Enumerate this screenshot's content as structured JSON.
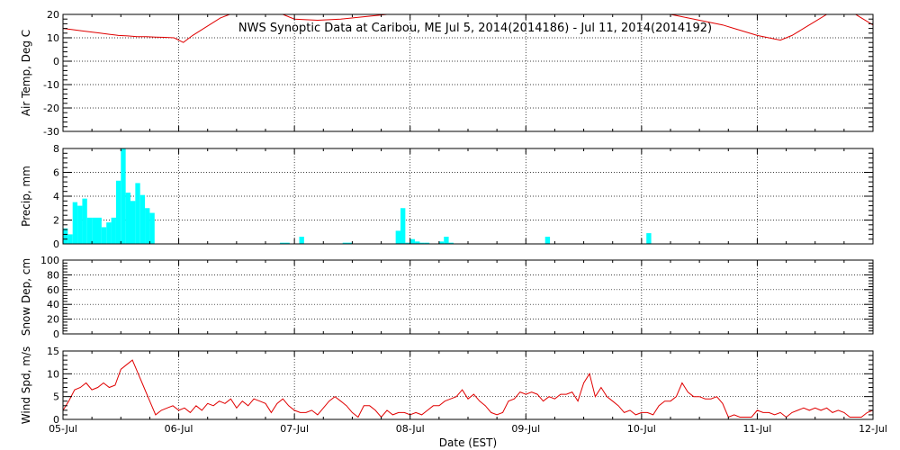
{
  "chart_data": {
    "type": "multi-panel",
    "title": "NWS Synoptic Data at Caribou, ME   Jul  5, 2014(2014186) - Jul 11, 2014(2014192)",
    "xlabel": "Date (EST)",
    "x_ticks": [
      "05-Jul",
      "06-Jul",
      "07-Jul",
      "08-Jul",
      "09-Jul",
      "10-Jul",
      "11-Jul",
      "12-Jul"
    ],
    "x_range_days": [
      0,
      7
    ],
    "colors": {
      "line": "#e00000",
      "bar": "#00ffff",
      "axis": "#000000"
    },
    "panels": [
      {
        "id": "air_temp",
        "type": "line",
        "ylabel": "Air Temp, Deg C",
        "ylim": [
          -30,
          20
        ],
        "yticks": [
          -30,
          -20,
          -10,
          0,
          10,
          20
        ],
        "grid": true,
        "series": [
          {
            "x": [
              0,
              0.08,
              0.16,
              0.24,
              0.32,
              0.4,
              0.48,
              0.56,
              0.64,
              0.72,
              0.8,
              0.88,
              0.96,
              1.04,
              1.12,
              1.2,
              1.28,
              1.36,
              1.44,
              1.52,
              1.6,
              1.7,
              1.8,
              1.9,
              2.0,
              2.2,
              2.4,
              2.6,
              2.8,
              3.0,
              3.2,
              3.4,
              3.6,
              3.8,
              4.0,
              4.2,
              4.4,
              4.6,
              4.8,
              5.0,
              5.1,
              5.2,
              5.3,
              5.4,
              5.5,
              5.6,
              5.7,
              5.8,
              5.9,
              6.0,
              6.1,
              6.2,
              6.3,
              6.4,
              6.5,
              6.6,
              6.7,
              6.8,
              6.9,
              7.0
            ],
            "values": [
              14,
              13.5,
              13,
              12.5,
              12,
              11.5,
              11,
              10.8,
              10.5,
              10.5,
              10.3,
              10.2,
              10,
              8,
              11,
              13.5,
              16,
              18.5,
              20,
              21,
              22,
              23,
              22,
              20,
              18,
              17.5,
              18,
              19,
              20,
              21,
              22,
              22.5,
              23,
              22,
              21,
              22,
              23,
              22,
              21,
              22,
              21.5,
              20.5,
              19.5,
              18.5,
              17.5,
              16.5,
              15.5,
              14,
              12.5,
              11,
              10,
              9,
              11,
              14,
              17,
              20,
              22,
              21.5,
              18.5,
              15.5
            ]
          }
        ]
      },
      {
        "id": "precip",
        "type": "bar",
        "ylabel": "Precip, mm",
        "ylim": [
          0,
          8
        ],
        "yticks": [
          0,
          2,
          4,
          6,
          8
        ],
        "grid": true,
        "bar_width_days": 0.0417,
        "series": [
          {
            "x": [
              0,
              0.0417,
              0.0833,
              0.125,
              0.1667,
              0.2083,
              0.25,
              0.2917,
              0.3333,
              0.375,
              0.4167,
              0.4583,
              0.5,
              0.5417,
              0.5833,
              0.625,
              0.6667,
              0.7083,
              0.75,
              1.875,
              1.9167,
              2.0417,
              2.4167,
              2.4583,
              2.875,
              2.9167,
              2.9583,
              3.0,
              3.0417,
              3.0833,
              3.125,
              3.25,
              3.2917,
              3.3333,
              4.1667,
              5.0417
            ],
            "values": [
              1.3,
              0.8,
              3.5,
              3.2,
              3.8,
              2.2,
              2.2,
              2.2,
              1.4,
              1.8,
              2.2,
              5.3,
              8.0,
              4.3,
              3.6,
              5.1,
              4.1,
              3.0,
              2.6,
              0.1,
              0.1,
              0.6,
              0.1,
              0.1,
              1.1,
              3.0,
              0.1,
              0.4,
              0.2,
              0.1,
              0.1,
              0.2,
              0.6,
              0.1,
              0.6,
              0.9
            ]
          }
        ]
      },
      {
        "id": "snow_dep",
        "type": "line",
        "ylabel": "Snow Dep, cm",
        "ylim": [
          0,
          100
        ],
        "yticks": [
          0,
          20,
          40,
          60,
          80,
          100
        ],
        "grid": true,
        "series": []
      },
      {
        "id": "wind_spd",
        "type": "line",
        "ylabel": "Wind Spd, m/s",
        "ylim": [
          0,
          15
        ],
        "yticks": [
          0,
          5,
          10,
          15
        ],
        "grid": true,
        "series": [
          {
            "x": [
              0,
              0.05,
              0.1,
              0.15,
              0.2,
              0.25,
              0.3,
              0.35,
              0.4,
              0.45,
              0.5,
              0.55,
              0.6,
              0.65,
              0.7,
              0.75,
              0.8,
              0.85,
              0.9,
              0.95,
              1.0,
              1.05,
              1.1,
              1.15,
              1.2,
              1.25,
              1.3,
              1.35,
              1.4,
              1.45,
              1.5,
              1.55,
              1.6,
              1.65,
              1.7,
              1.75,
              1.8,
              1.85,
              1.9,
              1.95,
              2.0,
              2.05,
              2.1,
              2.15,
              2.2,
              2.25,
              2.3,
              2.35,
              2.4,
              2.45,
              2.5,
              2.55,
              2.6,
              2.65,
              2.7,
              2.75,
              2.8,
              2.85,
              2.9,
              2.95,
              3.0,
              3.05,
              3.1,
              3.15,
              3.2,
              3.25,
              3.3,
              3.35,
              3.4,
              3.45,
              3.5,
              3.55,
              3.6,
              3.65,
              3.7,
              3.75,
              3.8,
              3.85,
              3.9,
              3.95,
              4.0,
              4.05,
              4.1,
              4.15,
              4.2,
              4.25,
              4.3,
              4.35,
              4.4,
              4.45,
              4.5,
              4.55,
              4.6,
              4.65,
              4.7,
              4.75,
              4.8,
              4.85,
              4.9,
              4.95,
              5.0,
              5.05,
              5.1,
              5.15,
              5.2,
              5.25,
              5.3,
              5.35,
              5.4,
              5.45,
              5.5,
              5.55,
              5.6,
              5.65,
              5.7,
              5.75,
              5.8,
              5.85,
              5.9,
              5.95,
              6.0,
              6.05,
              6.1,
              6.15,
              6.2,
              6.25,
              6.3,
              6.35,
              6.4,
              6.45,
              6.5,
              6.55,
              6.6,
              6.65,
              6.7,
              6.75,
              6.8,
              6.85,
              6.9,
              6.95,
              7.0
            ],
            "values": [
              2,
              4,
              6.5,
              7,
              8,
              6.5,
              7,
              8,
              7,
              7.5,
              11,
              12,
              13,
              10,
              7,
              4,
              1,
              2,
              2.5,
              3,
              2,
              2.5,
              1.5,
              3,
              2,
              3.5,
              3,
              4,
              3.5,
              4.5,
              2.5,
              4,
              3,
              4.5,
              4,
              3.5,
              1.5,
              3.5,
              4.5,
              3,
              2,
              1.5,
              1.5,
              2,
              1,
              2.5,
              4,
              5,
              4,
              3,
              1.5,
              0.5,
              3,
              3,
              2,
              0.5,
              2,
              1,
              1.5,
              1.5,
              1,
              1.5,
              1,
              2,
              3,
              3,
              4,
              4.5,
              5,
              6.5,
              4.5,
              5.5,
              4,
              3,
              1.5,
              1,
              1.5,
              4,
              4.5,
              6,
              5.5,
              6,
              5.5,
              4,
              5,
              4.5,
              5.5,
              5.5,
              6,
              4,
              8,
              10,
              5,
              7,
              5,
              4,
              3,
              1.5,
              2,
              1,
              1.5,
              1.5,
              1,
              3,
              4,
              4,
              5,
              8,
              6,
              5,
              5,
              4.5,
              4.5,
              5,
              3.5,
              0.5,
              1,
              0.5,
              0.5,
              0.5,
              2,
              1.5,
              1.5,
              1,
              1.5,
              0.5,
              1.5,
              2,
              2.5,
              2,
              2.5,
              2,
              2.5,
              1.5,
              2,
              1.5,
              0.5,
              0.5,
              0.5,
              1.5,
              2
            ]
          }
        ]
      }
    ]
  }
}
